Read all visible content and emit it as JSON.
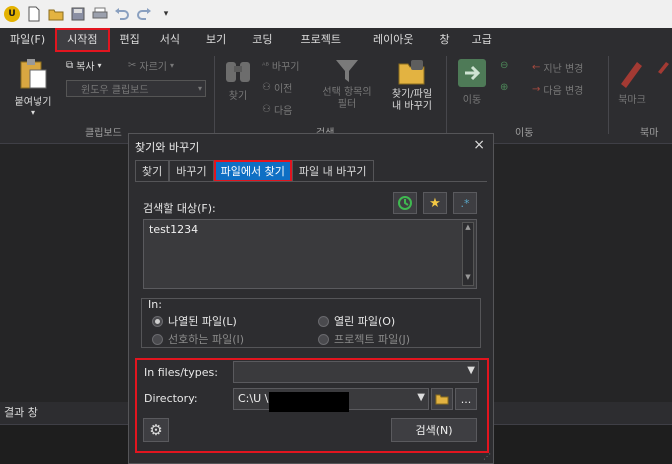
{
  "menu": {
    "tabs": [
      "파일(F)",
      "시작점",
      "편집",
      "서식",
      "보기",
      "코딩",
      "프로젝트",
      "레이아웃",
      "창",
      "고급"
    ]
  },
  "ribbon": {
    "paste": "붙여넣기",
    "copy": "복사",
    "cut": "자르기",
    "clipboard_select": "윈도우 클립보드",
    "group_clipboard": "클립보드",
    "find": "찾기",
    "replace": "바꾸기",
    "prev": "이전",
    "next": "다음",
    "filter": "선택 항목의\n필터",
    "group_search": "검색",
    "find_in_files": "찾기/파일\n내 바꾸기",
    "goto": "이동",
    "last_change": "지난 변경",
    "next_change": "다음 변경",
    "group_navigate": "이동",
    "bookmark": "북마크",
    "group_bookmark": "북마"
  },
  "workspace": {
    "results_label": "결과 창"
  },
  "dialog": {
    "title": "찾기와 바꾸기",
    "close": "×",
    "tabs": [
      "찾기",
      "바꾸기",
      "파일에서 찾기",
      "파일 내 바꾸기"
    ],
    "search_label": "검색할 대상(F):",
    "search_value": "test1234",
    "in_group": "In:",
    "opt_listed": "나열된 파일(L)",
    "opt_open": "열린 파일(O)",
    "opt_favorites": "선호하는 파일(I)",
    "opt_project": "프로젝트 파일(J)",
    "in_files_label": "In files/types:",
    "in_files_value": "",
    "directory_label": "Directory:",
    "directory_value": "C:\\U                          \\dump\\fric",
    "browse_more": "...",
    "search_button": "검색(N)"
  }
}
